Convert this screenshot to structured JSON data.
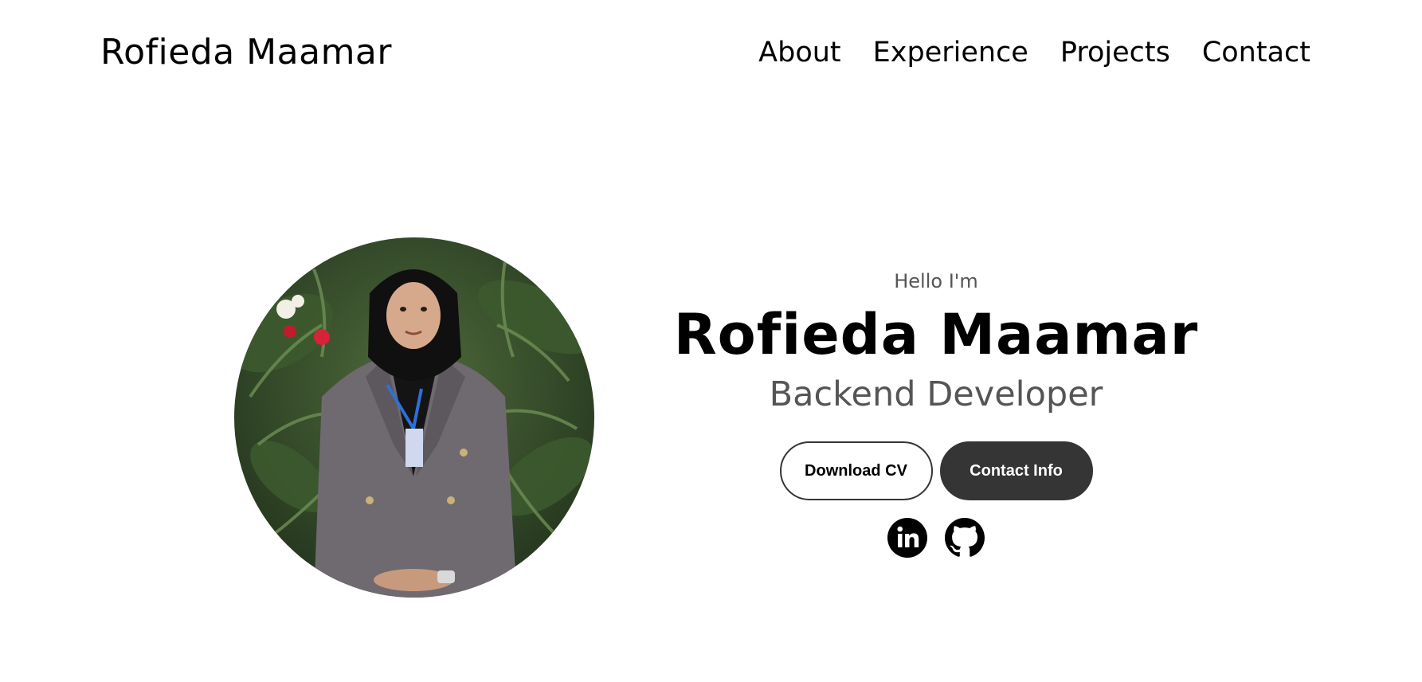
{
  "nav": {
    "logo": "Rofieda Maamar",
    "links": [
      {
        "label": "About"
      },
      {
        "label": "Experience"
      },
      {
        "label": "Projects"
      },
      {
        "label": "Contact"
      }
    ]
  },
  "hero": {
    "greeting": "Hello I'm",
    "name": "Rofieda Maamar",
    "role": "Backend Developer",
    "buttons": {
      "download_cv": "Download CV",
      "contact_info": "Contact Info"
    },
    "socials": [
      {
        "icon": "linkedin-icon"
      },
      {
        "icon": "github-icon"
      }
    ],
    "profile_image": "profile-photo"
  },
  "colors": {
    "text": "#000000",
    "muted": "#555555",
    "button_dark": "#353535",
    "background": "#ffffff"
  }
}
